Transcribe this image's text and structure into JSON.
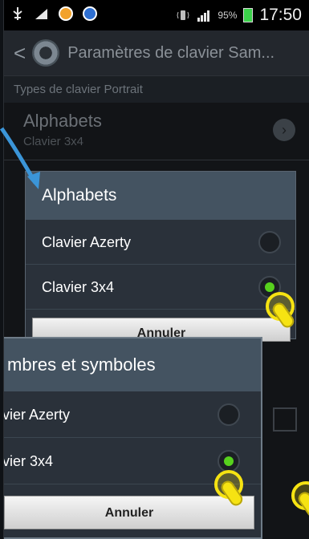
{
  "status_bar": {
    "battery_percent": "95%",
    "time": "17:50"
  },
  "action_bar": {
    "title": "Paramètres de clavier Sam..."
  },
  "settings": {
    "section_header": "Types de clavier Portrait",
    "row": {
      "title": "Alphabets",
      "subtitle": "Clavier 3x4"
    }
  },
  "dialog_alphabets": {
    "title": "Alphabets",
    "options": [
      {
        "label": "Clavier Azerty",
        "selected": false
      },
      {
        "label": "Clavier 3x4",
        "selected": true
      }
    ],
    "cancel_label": "Annuler"
  },
  "dialog_numbers": {
    "title": "mbres et symboles",
    "options": [
      {
        "label": "vier Azerty",
        "selected": false
      },
      {
        "label": "vier 3x4",
        "selected": true
      }
    ],
    "cancel_label": "Annuler"
  },
  "colors": {
    "dialog_header": "#445361",
    "radio_checked": "#57d11d",
    "pointer": "#f6e312",
    "arrow": "#3b95d8"
  },
  "icons": {
    "back": "back-chevron-icon",
    "settings": "gear-icon",
    "chevron": "chevron-right-icon"
  }
}
